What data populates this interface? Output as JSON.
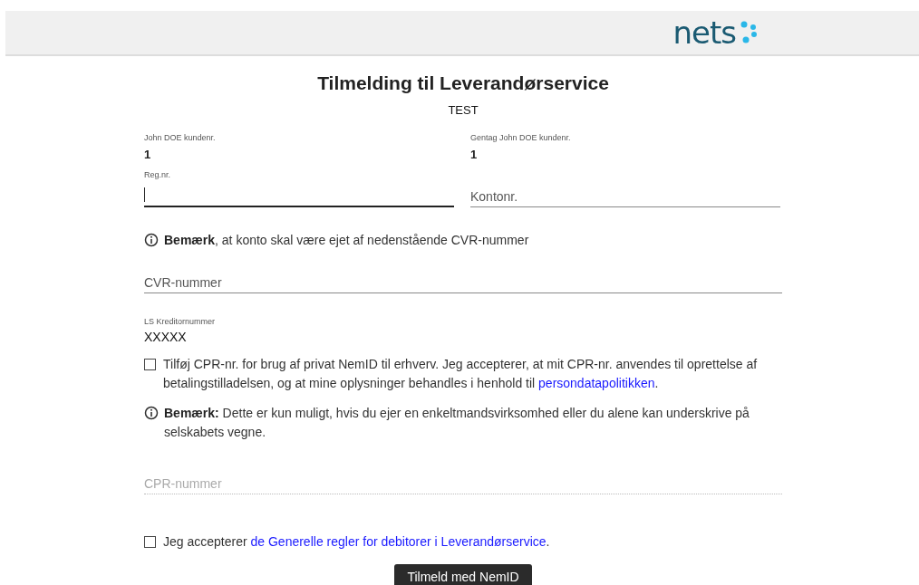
{
  "header": {
    "logo_text": "nets"
  },
  "title": "Tilmelding til Leverandørservice",
  "subtitle": "TEST",
  "info_pairs": [
    {
      "label": "John DOE kundenr.",
      "value": "1"
    },
    {
      "label": "Gentag John DOE kundenr.",
      "value": "1"
    }
  ],
  "account_fields": [
    {
      "label": "Reg.nr.",
      "focused": true
    },
    {
      "placeholder": "Kontonr.",
      "focused": false
    }
  ],
  "note_1": "**Bemærk**, at konto skal være ejet af nedenstående CVR-nummer",
  "cvr_field": {
    "placeholder": "CVR-nummer",
    "disabled": false
  },
  "creditor": {
    "label": "LS Kreditornummer",
    "value": "XXXXX"
  },
  "cpr_consent": {
    "checked": false,
    "text": "Tilføj CPR-nr. for brug af privat NemID til erhverv. Jeg accepterer, at mit CPR-nr. anvendes til oprettelse af betalingstilladelsen, og at mine oplysninger behandles i henhold til ",
    "link": "persondatapolitikken",
    "after": "."
  },
  "note_2": "**Bemærk:** Dette er kun muligt, hvis du ejer en enkeltmandsvirksomhed eller du alene kan underskrive på selskabets vegne.",
  "cpr_field": {
    "placeholder": "CPR-nummer",
    "disabled": true
  },
  "terms_consent": {
    "checked": false,
    "text": "Jeg accepterer ",
    "link": "de Generelle regler for debitorer i Leverandørservice",
    "after": "."
  },
  "submit_button": "Tilmeld med NemID"
}
